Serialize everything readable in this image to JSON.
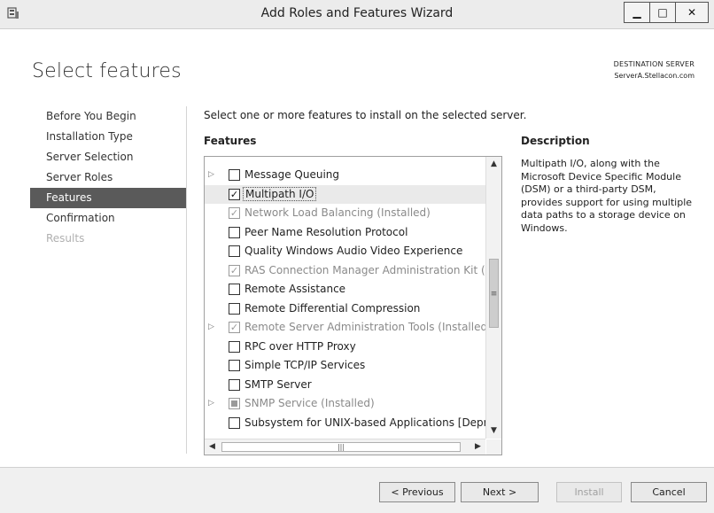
{
  "window": {
    "title": "Add Roles and Features Wizard",
    "icon": "server-manager-icon",
    "minimize": "minimize-icon",
    "maximize": "maximize-icon",
    "close": "close-icon"
  },
  "header": {
    "page_title": "Select features",
    "destination_label": "DESTINATION SERVER",
    "destination_server": "ServerA.Stellacon.com"
  },
  "nav": [
    {
      "label": "Before You Begin",
      "state": "normal"
    },
    {
      "label": "Installation Type",
      "state": "normal"
    },
    {
      "label": "Server Selection",
      "state": "normal"
    },
    {
      "label": "Server Roles",
      "state": "normal"
    },
    {
      "label": "Features",
      "state": "active"
    },
    {
      "label": "Confirmation",
      "state": "normal"
    },
    {
      "label": "Results",
      "state": "disabled"
    }
  ],
  "main": {
    "instruction": "Select one or more features to install on the selected server.",
    "features_heading": "Features",
    "description_heading": "Description",
    "description_text": "Multipath I/O, along with the Microsoft Device Specific Module (DSM) or a third-party DSM, provides support for using multiple data paths to a storage device on Windows."
  },
  "features": [
    {
      "label": "Message Queuing",
      "expandable": true,
      "check": "unchecked",
      "dim": false,
      "selected": false
    },
    {
      "label": "Multipath I/O",
      "expandable": false,
      "check": "checked",
      "dim": false,
      "selected": true
    },
    {
      "label": "Network Load Balancing (Installed)",
      "expandable": false,
      "check": "checked",
      "dim": true,
      "selected": false
    },
    {
      "label": "Peer Name Resolution Protocol",
      "expandable": false,
      "check": "unchecked",
      "dim": false,
      "selected": false
    },
    {
      "label": "Quality Windows Audio Video Experience",
      "expandable": false,
      "check": "unchecked",
      "dim": false,
      "selected": false
    },
    {
      "label": "RAS Connection Manager Administration Kit (CMA",
      "expandable": false,
      "check": "checked",
      "dim": true,
      "selected": false
    },
    {
      "label": "Remote Assistance",
      "expandable": false,
      "check": "unchecked",
      "dim": false,
      "selected": false
    },
    {
      "label": "Remote Differential Compression",
      "expandable": false,
      "check": "unchecked",
      "dim": false,
      "selected": false
    },
    {
      "label": "Remote Server Administration Tools (Installed)",
      "expandable": true,
      "check": "checked",
      "dim": true,
      "selected": false
    },
    {
      "label": "RPC over HTTP Proxy",
      "expandable": false,
      "check": "unchecked",
      "dim": false,
      "selected": false
    },
    {
      "label": "Simple TCP/IP Services",
      "expandable": false,
      "check": "unchecked",
      "dim": false,
      "selected": false
    },
    {
      "label": "SMTP Server",
      "expandable": false,
      "check": "unchecked",
      "dim": false,
      "selected": false
    },
    {
      "label": "SNMP Service (Installed)",
      "expandable": true,
      "check": "indeterminate",
      "dim": true,
      "selected": false
    },
    {
      "label": "Subsystem for UNIX-based Applications [Deprecat",
      "expandable": false,
      "check": "unchecked",
      "dim": false,
      "selected": false
    }
  ],
  "icons": {
    "expand": "expand-arrow-icon",
    "scroll_up": "scroll-up-icon",
    "scroll_down": "scroll-down-icon",
    "scroll_left": "scroll-left-icon",
    "scroll_right": "scroll-right-icon",
    "thumb_grip": "grip-icon"
  },
  "footer": {
    "previous": "< Previous",
    "next": "Next >",
    "install": "Install",
    "cancel": "Cancel"
  }
}
